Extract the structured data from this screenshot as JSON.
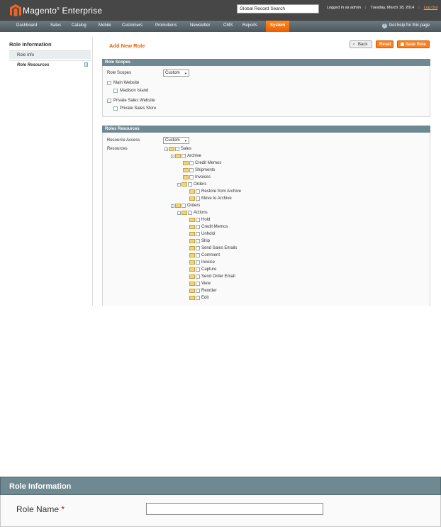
{
  "header": {
    "brand_name": "Magento",
    "brand_suffix": "Enterprise",
    "global_search_value": "Global Record Search",
    "logged_in": "Logged in as admin",
    "date": "Tuesday, March 18, 2014",
    "logout": "Log Out"
  },
  "nav": {
    "items": [
      "Dashboard",
      "Sales",
      "Catalog",
      "Mobile",
      "Customers",
      "Promotions",
      "Newsletter",
      "CMS",
      "Reports",
      "System"
    ],
    "active": "System",
    "help": "Get help for this page"
  },
  "sidebar": {
    "title": "Role Information",
    "items": [
      {
        "label": "Role Info"
      },
      {
        "label": "Role Resources"
      }
    ]
  },
  "page": {
    "title": "Add New Role",
    "buttons": {
      "back": "Back",
      "reset": "Reset",
      "save": "Save Role"
    }
  },
  "role_scopes": {
    "header": "Role Scopes",
    "scope_label": "Role Scopes",
    "scope_value": "Custom",
    "websites": [
      {
        "name": "Main Website",
        "stores": [
          "Madison Island"
        ]
      },
      {
        "name": "Private Sales Website",
        "stores": [
          "Private Sales Store"
        ]
      }
    ]
  },
  "roles_resources": {
    "header": "Roles Resources",
    "access_label": "Resource Access",
    "access_value": "Custom",
    "resources_label": "Resources",
    "tree": [
      {
        "label": "Sales",
        "level": 0,
        "expander": "-"
      },
      {
        "label": "Archive",
        "level": 1,
        "expander": "-"
      },
      {
        "label": "Credit Memos",
        "level": 2
      },
      {
        "label": "Shipments",
        "level": 2
      },
      {
        "label": "Invoices",
        "level": 2
      },
      {
        "label": "Orders",
        "level": 2,
        "expander": "-"
      },
      {
        "label": "Restore from Archive",
        "level": 3
      },
      {
        "label": "Move to Archive",
        "level": 3
      },
      {
        "label": "Orders",
        "level": 1,
        "expander": "-"
      },
      {
        "label": "Actions",
        "level": 2,
        "expander": "-"
      },
      {
        "label": "Hold",
        "level": 3
      },
      {
        "label": "Credit Memos",
        "level": 3
      },
      {
        "label": "Unhold",
        "level": 3
      },
      {
        "label": "Ship",
        "level": 3
      },
      {
        "label": "Send Sales Emails",
        "level": 3
      },
      {
        "label": "Comment",
        "level": 3
      },
      {
        "label": "Invoice",
        "level": 3
      },
      {
        "label": "Capture",
        "level": 3
      },
      {
        "label": "Send Order Email",
        "level": 3
      },
      {
        "label": "View",
        "level": 3
      },
      {
        "label": "Reorder",
        "level": 3
      },
      {
        "label": "Edit",
        "level": 3
      }
    ]
  },
  "role_information_panel": {
    "header": "Role Information",
    "field_label": "Role Name",
    "required_mark": "*",
    "field_value": ""
  },
  "colors": {
    "accent": "#eb5e00",
    "section_header": "#6f8992",
    "header_bg": "#474747"
  }
}
